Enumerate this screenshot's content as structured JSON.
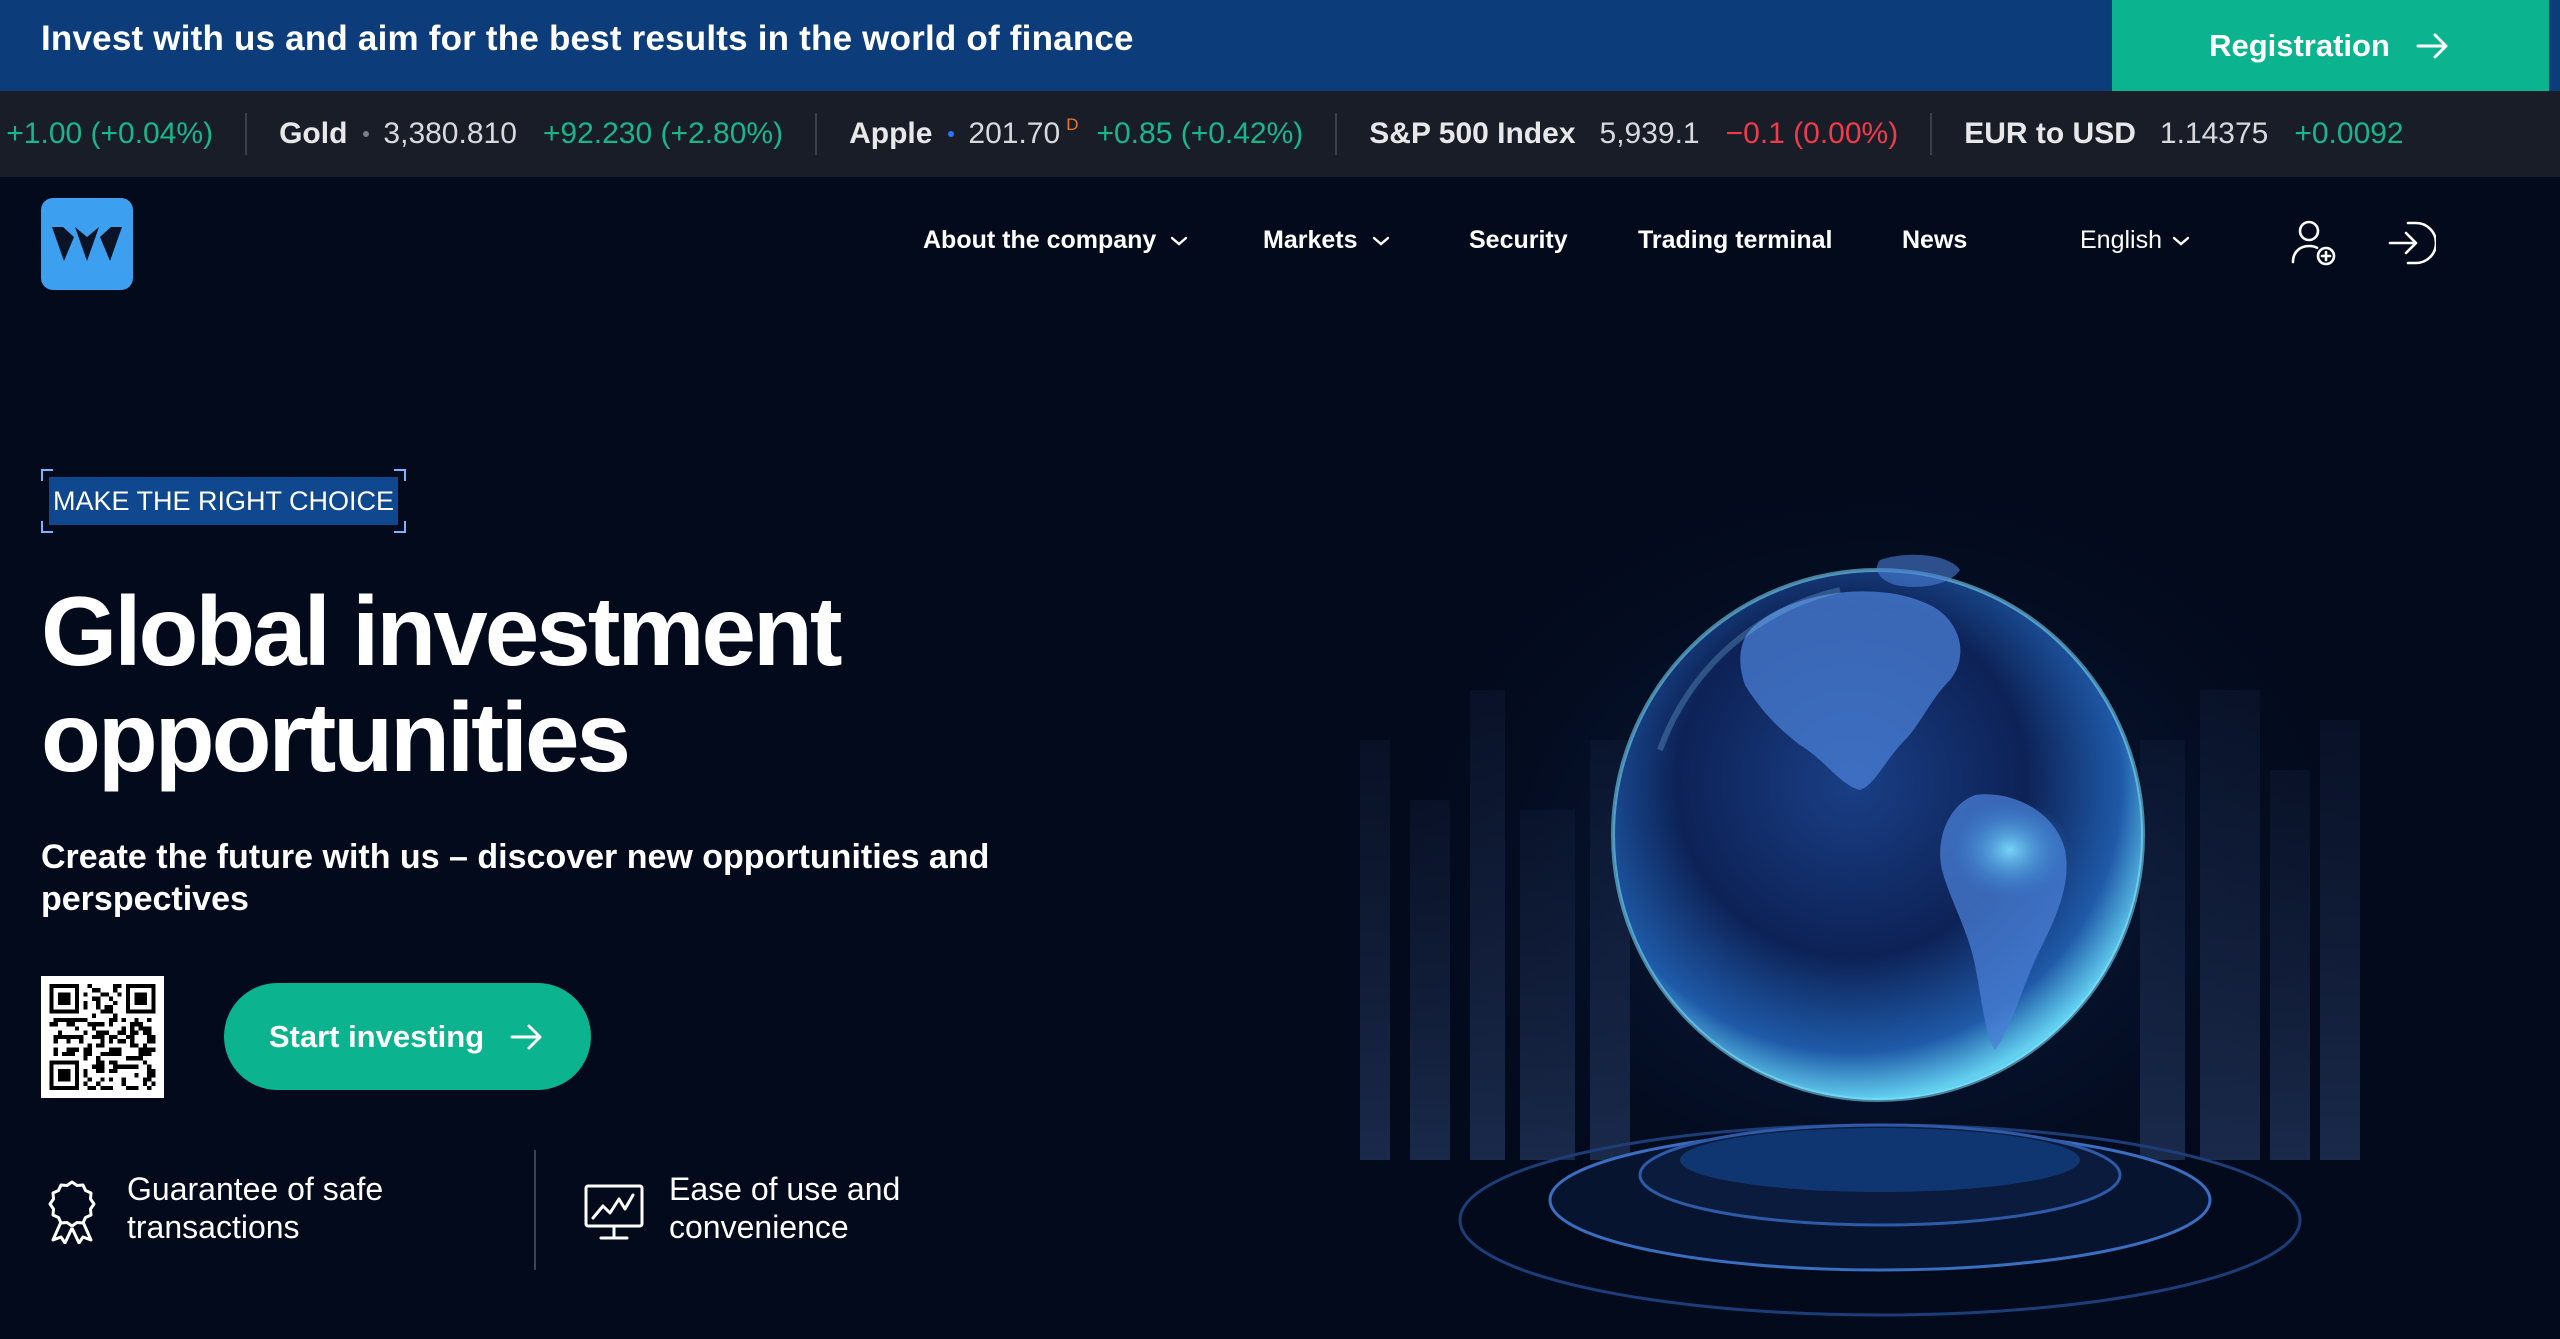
{
  "banner": {
    "text": "Invest with us and aim for the best results in the world of finance",
    "registration_label": "Registration"
  },
  "ticker": [
    {
      "name": "",
      "price": "",
      "change": "+1.00 (+0.04%)",
      "direction": "up",
      "delayed": true
    },
    {
      "name": "Gold",
      "price": "3,380.810",
      "change": "+92.230 (+2.80%)",
      "direction": "up",
      "delayed": false
    },
    {
      "name": "Apple",
      "price": "201.70",
      "change": "+0.85 (+0.42%)",
      "direction": "up",
      "delayed": true
    },
    {
      "name": "S&P 500 Index",
      "price": "5,939.1",
      "change": "−0.1 (0.00%)",
      "direction": "down",
      "delayed": false
    },
    {
      "name": "EUR to USD",
      "price": "1.14375",
      "change": "+0.0092",
      "direction": "up",
      "delayed": false
    }
  ],
  "ticker_delay_marker": "D",
  "nav": {
    "about": "About the company",
    "markets": "Markets",
    "security": "Security",
    "trading_terminal": "Trading terminal",
    "news": "News",
    "language": "English"
  },
  "hero": {
    "tag": "MAKE THE RIGHT CHOICE",
    "title_line1": "Global investment",
    "title_line2": "opportunities",
    "subtitle": "Create the future with us – discover new opportunities and perspectives",
    "cta_label": "Start investing"
  },
  "features": [
    {
      "icon": "award-ribbon-icon",
      "text_line1": "Guarantee of safe",
      "text_line2": "transactions"
    },
    {
      "icon": "chart-monitor-icon",
      "text_line1": "Ease of use and",
      "text_line2": "convenience"
    }
  ],
  "colors": {
    "background": "#030a1c",
    "banner": "#0c3d7a",
    "accent_green": "#0bb48e",
    "ticker_bg": "#191d27",
    "up": "#19b68a",
    "down": "#ef3b4a",
    "logo_blue": "#3d9ff0"
  }
}
